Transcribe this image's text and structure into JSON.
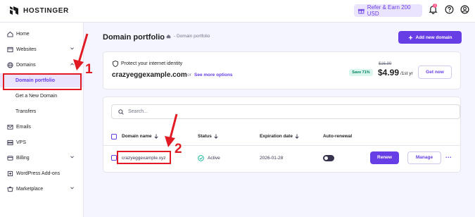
{
  "topbar": {
    "logo_text": "HOSTINGER",
    "refer_label": "Refer & Earn 200 USD",
    "notification_count": "1",
    "icons": [
      "gift-icon",
      "bell-icon",
      "help-icon",
      "account-icon"
    ]
  },
  "sidebar": {
    "items": [
      {
        "label": "Home",
        "icon": "home-icon"
      },
      {
        "label": "Websites",
        "icon": "websites-icon"
      },
      {
        "label": "Domains",
        "icon": "globe-icon"
      },
      {
        "label": "Domain portfolio"
      },
      {
        "label": "Get a New Domain"
      },
      {
        "label": "Transfers"
      },
      {
        "label": "Emails",
        "icon": "mail-icon"
      },
      {
        "label": "VPS",
        "icon": "server-icon"
      },
      {
        "label": "Billing",
        "icon": "billing-icon"
      },
      {
        "label": "WordPress Add-ons",
        "icon": "wordpress-icon"
      },
      {
        "label": "Marketplace",
        "icon": "marketplace-icon"
      }
    ]
  },
  "header": {
    "title": "Domain portfolio",
    "breadcrumb": "- Domain portfolio",
    "add_button": "Add new domain"
  },
  "promo": {
    "headline": "Protect your internet identity",
    "domain": "crazyeggexample.com",
    "or_text": "or",
    "more_options": "See more options",
    "save_badge": "Save 71%",
    "old_price": "$16.99",
    "price": "$4.99",
    "per_year": "/1st yr",
    "cta": "Get now"
  },
  "search": {
    "placeholder": "Search..."
  },
  "table": {
    "columns": [
      "Domain name",
      "Status",
      "Expiration date",
      "Auto-renewal"
    ],
    "rows": [
      {
        "domain": "crazyeggexample.xyz",
        "status": "Active",
        "expiration": "2026-01-28",
        "auto_renewal": "off",
        "renew_label": "Renew",
        "manage_label": "Manage",
        "more_label": "..."
      }
    ]
  },
  "annotations": {
    "step1": "1",
    "step2": "2",
    "color": "#e01b24"
  },
  "colors": {
    "accent": "#673de6",
    "active_status": "#00b090"
  }
}
